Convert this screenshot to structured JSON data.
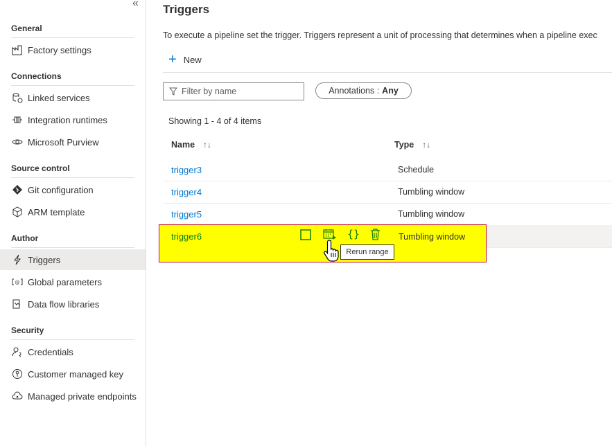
{
  "sidebar": {
    "collapse_glyph": "«",
    "sections": {
      "general": "General",
      "connections": "Connections",
      "source_control": "Source control",
      "author": "Author",
      "security": "Security"
    },
    "items": {
      "factory_settings": "Factory settings",
      "linked_services": "Linked services",
      "integration_runtimes": "Integration runtimes",
      "microsoft_purview": "Microsoft Purview",
      "git_configuration": "Git configuration",
      "arm_template": "ARM template",
      "triggers": "Triggers",
      "global_parameters": "Global parameters",
      "data_flow_libraries": "Data flow libraries",
      "credentials": "Credentials",
      "customer_managed_key": "Customer managed key",
      "managed_private_endpoints": "Managed private endpoints"
    },
    "active_item": "triggers"
  },
  "main": {
    "title": "Triggers",
    "description": "To execute a pipeline set the trigger. Triggers represent a unit of processing that determines when a pipeline exec",
    "new_label": "New",
    "filter_placeholder": "Filter by name",
    "annotations_label": "Annotations :",
    "annotations_value": "Any",
    "showing_text": "Showing 1 - 4 of 4 items",
    "columns": {
      "name": "Name",
      "type": "Type",
      "sort_glyph": "↑↓"
    },
    "rows": [
      {
        "name": "trigger3",
        "type": "Schedule"
      },
      {
        "name": "trigger4",
        "type": "Tumbling window"
      },
      {
        "name": "trigger5",
        "type": "Tumbling window"
      },
      {
        "name": "trigger6",
        "type": "Tumbling window"
      }
    ],
    "tooltip": "Rerun range",
    "row_actions": [
      "checkbox-icon",
      "rerun-range-icon",
      "json-code-icon",
      "delete-icon"
    ]
  },
  "colors": {
    "link": "#0078d4",
    "highlight": "#ffff00",
    "highlight_border": "#c50f1f",
    "action_green": "#107c10"
  }
}
